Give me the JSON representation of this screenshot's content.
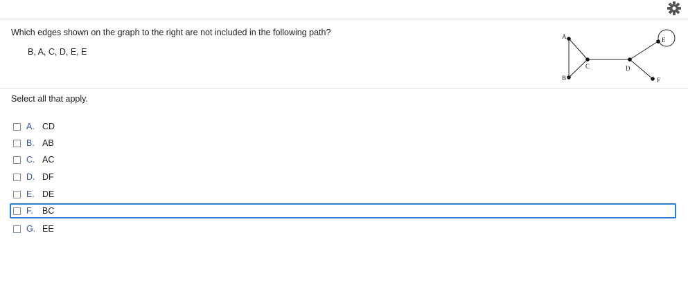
{
  "question": {
    "text": "Which edges shown on the graph to the right are not included in the following path?",
    "path": "B, A, C, D, E, E"
  },
  "graph": {
    "nodes": {
      "A": "A",
      "B": "B",
      "C": "C",
      "D": "D",
      "E": "E",
      "F": "F"
    }
  },
  "instruction": "Select all that apply.",
  "options": [
    {
      "letter": "A.",
      "label": "CD",
      "checked": false
    },
    {
      "letter": "B.",
      "label": "AB",
      "checked": false
    },
    {
      "letter": "C.",
      "label": "AC",
      "checked": false
    },
    {
      "letter": "D.",
      "label": "DF",
      "checked": false
    },
    {
      "letter": "E.",
      "label": "DE",
      "checked": false
    },
    {
      "letter": "F.",
      "label": "BC",
      "checked": false,
      "focused": true
    },
    {
      "letter": "G.",
      "label": "EE",
      "checked": false
    }
  ],
  "icons": {
    "settings": "gear-icon"
  },
  "colors": {
    "focus_border": "#2a7fd4",
    "option_letter": "#3355aa"
  }
}
